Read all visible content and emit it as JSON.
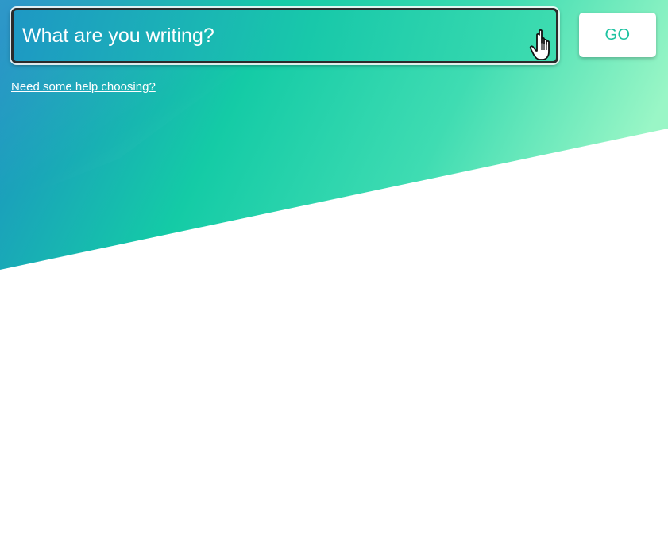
{
  "search": {
    "placeholder": "What are you writing?",
    "value": ""
  },
  "go_button": {
    "label": "GO"
  },
  "help_link": {
    "label": "Need some help choosing?"
  },
  "colors": {
    "gradient_start": "#1d8fc4",
    "gradient_mid": "#14cba6",
    "gradient_end": "#9af6c6",
    "button_text": "#1cc2a0",
    "background": "#ffffff"
  },
  "icons": {
    "cursor": "hand-pointer-icon"
  }
}
